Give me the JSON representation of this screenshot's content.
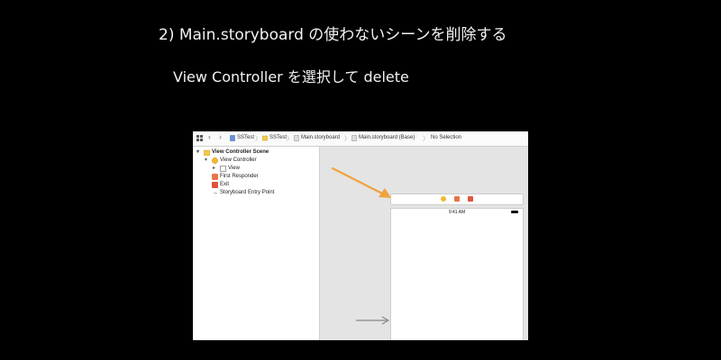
{
  "slide": {
    "heading": "2) Main.storyboard の使わないシーンを削除する",
    "subheading": "View Controller を選択して delete"
  },
  "jumpbar": {
    "items": [
      "SSTest",
      "SSTest",
      "Main.storyboard",
      "Main.storyboard (Base)",
      "No Selection"
    ]
  },
  "outline": {
    "scene": "View Controller Scene",
    "view_controller": "View Controller",
    "view": "View",
    "first_responder": "First Responder",
    "exit": "Exit",
    "entry_point": "Storyboard Entry Point"
  },
  "canvas": {
    "status_time": "9:41 AM"
  },
  "colors": {
    "annotation_arrow": "#f0a23c",
    "folder": "#f2c94c",
    "vc_icon": "#f5b731",
    "responder_icon": "#e8744a",
    "exit_icon": "#e0533b"
  }
}
